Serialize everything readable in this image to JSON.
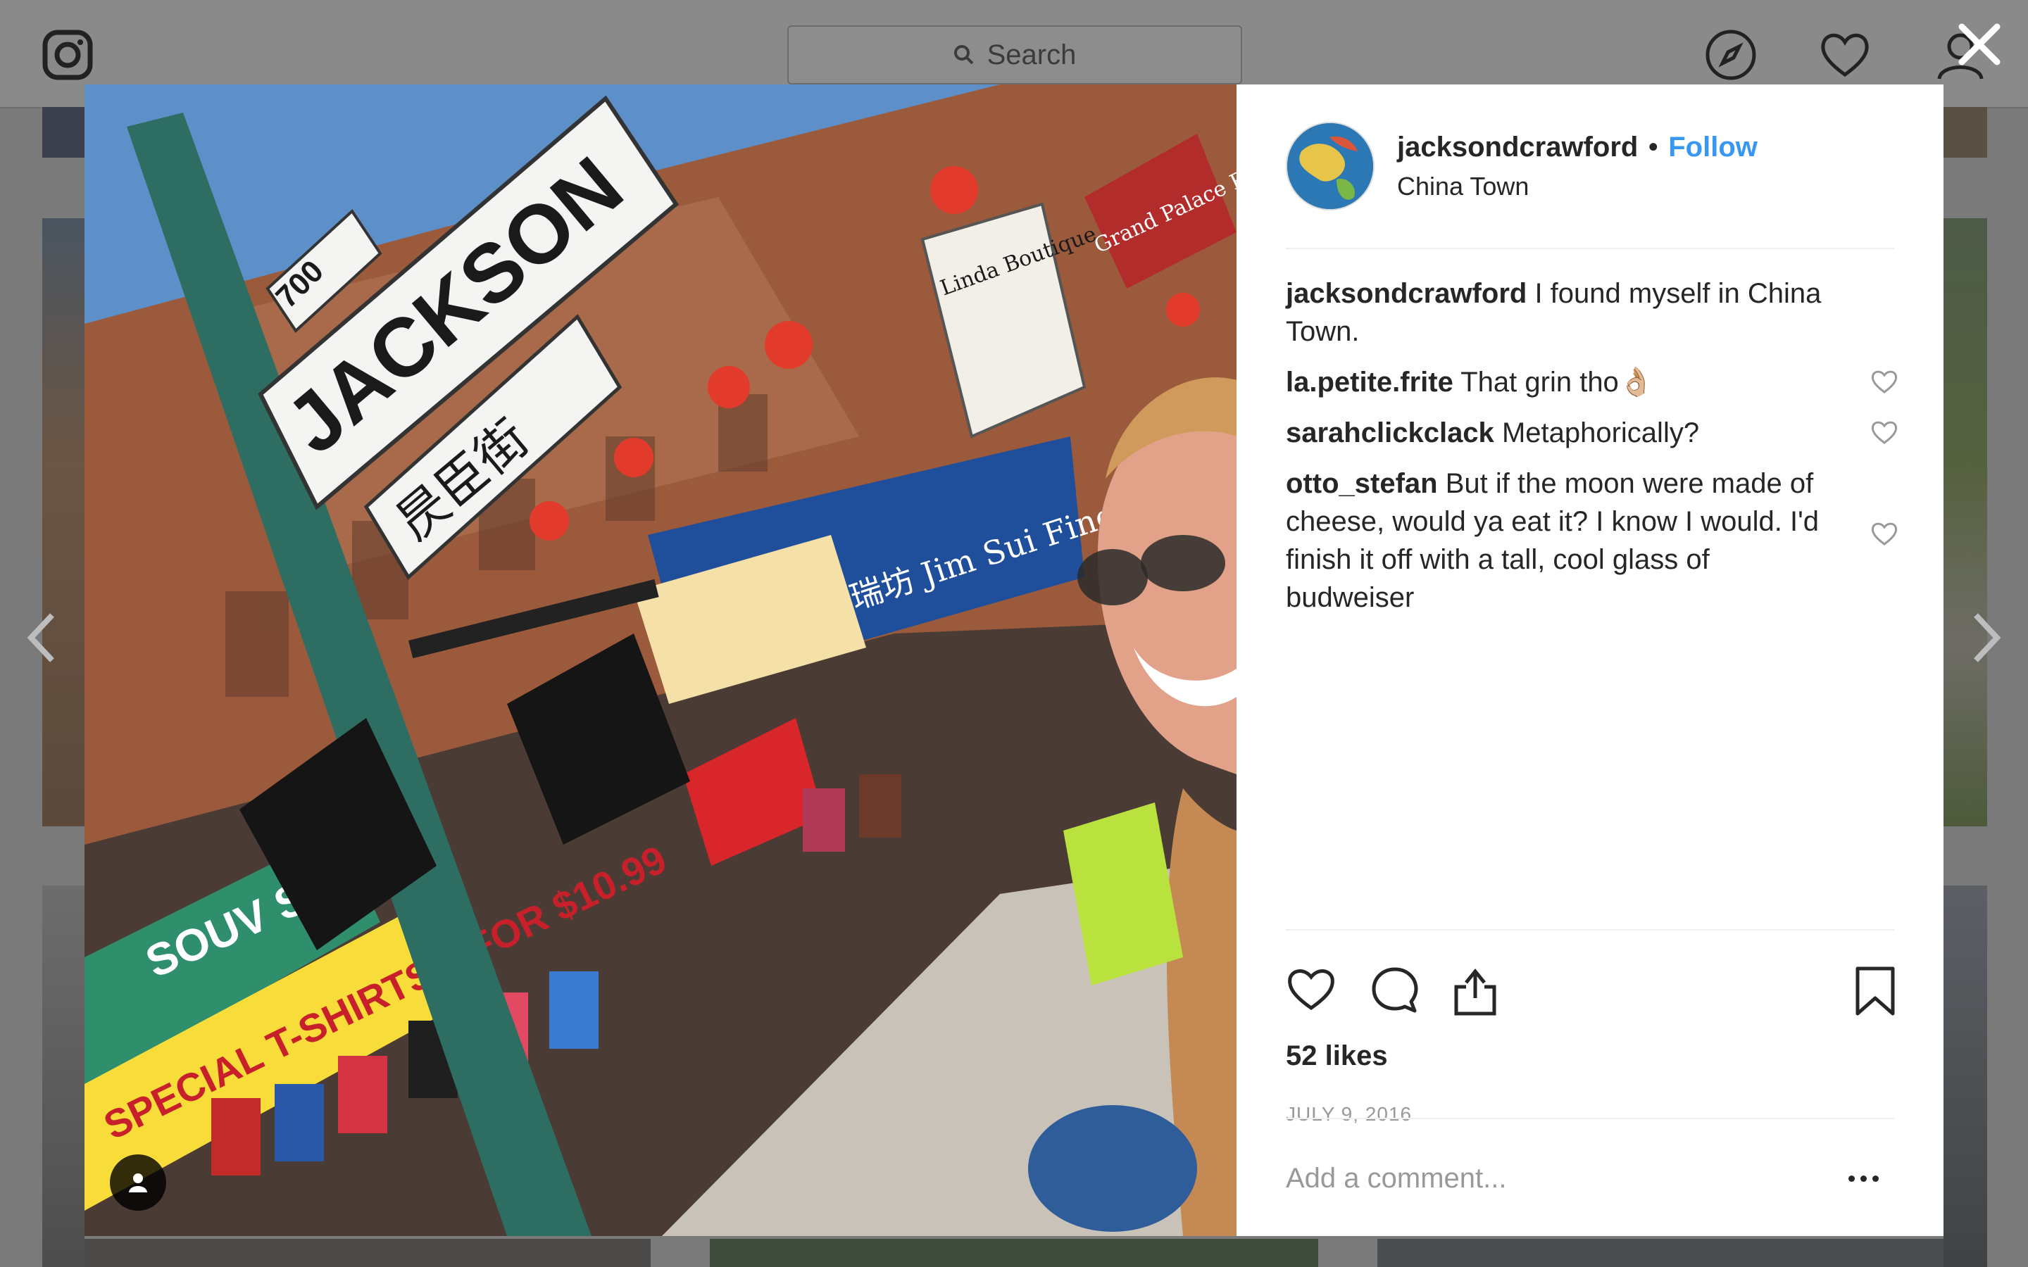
{
  "search": {
    "label": "Search"
  },
  "post": {
    "username": "jacksondcrawford",
    "separator": "•",
    "follow_label": "Follow",
    "location": "China Town",
    "caption": {
      "user": "jacksondcrawford",
      "text": "I found myself in China Town."
    },
    "comments": [
      {
        "user": "la.petite.frite",
        "text": "That grin tho👌🏼"
      },
      {
        "user": "sarahclickclack",
        "text": "Metaphorically?"
      },
      {
        "user": "otto_stefan",
        "text": "But if the moon were made of cheese, would ya eat it? I know I would. I'd finish it off with a tall, cool glass of budweiser"
      }
    ],
    "likes": "52 likes",
    "date": "JULY 9, 2016",
    "add_comment_placeholder": "Add a comment..."
  },
  "photo": {
    "signs": {
      "street": "JACKSON",
      "number": "700",
      "chinese": "昃臣街",
      "shop": "Linda Boutique",
      "restaurant": "Grand Palace RESTAURANT",
      "souvenir": "SOUV SH",
      "special": "SPECIAL T-SHIRTS 5 FOR $10.99",
      "blue_shop": "金瑞坊 Jim Sui Fine Scarfs, Socks"
    }
  },
  "colors": {
    "accent": "#3897f0",
    "text": "#262626",
    "muted": "#999999"
  }
}
